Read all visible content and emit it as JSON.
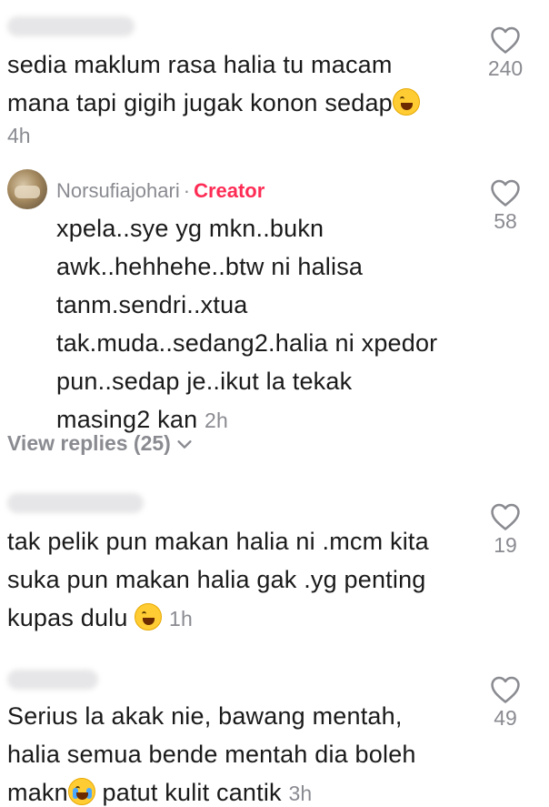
{
  "comments": [
    {
      "lines": [
        "sedia maklum rasa halia tu macam",
        "mana tapi gigih jugak konon sedap"
      ],
      "time": "4h",
      "likes": "240"
    },
    {
      "username": "Norsufiajohari",
      "badge": "Creator",
      "lines": [
        "xpela..sye yg mkn..bukn",
        "awk..hehhehe..btw ni halisa",
        "tanm.sendri..xtua",
        "tak.muda..sedang2.halia ni xpedor",
        "pun..sedap je..ikut la tekak",
        "masing2 kan"
      ],
      "time": "2h",
      "likes": "58"
    },
    {
      "lines": [
        "tak pelik pun makan halia ni .mcm kita",
        "suka pun makan halia gak .yg penting",
        "kupas dulu"
      ],
      "time": "1h",
      "likes": "19"
    },
    {
      "lines": [
        "Serius la akak nie, bawang mentah,",
        "halia semua bende mentah dia boleh",
        "makn",
        " patut kulit cantik"
      ],
      "time": "3h",
      "likes": "49"
    }
  ],
  "view_replies": "View replies (25)",
  "icons": {
    "like": "heart-outline-icon",
    "chevron": "chevron-down-icon"
  }
}
